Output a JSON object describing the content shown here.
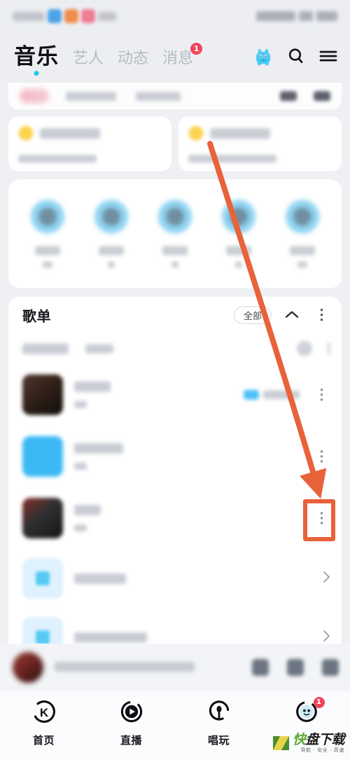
{
  "statusbar": {
    "left_label": "blurred-carrier",
    "right_label": "blurred-indicators"
  },
  "header": {
    "tabs": [
      {
        "label": "音乐",
        "active": true,
        "badge": ""
      },
      {
        "label": "艺人",
        "active": false,
        "badge": ""
      },
      {
        "label": "动态",
        "active": false,
        "badge": ""
      },
      {
        "label": "消息",
        "active": false,
        "badge": "1"
      }
    ],
    "actions": [
      {
        "name": "mascot-icon",
        "label": ""
      },
      {
        "name": "search-icon",
        "label": ""
      },
      {
        "name": "hamburger-menu-icon",
        "label": ""
      }
    ],
    "accent_color": "#1fc6e8",
    "badge_color": "#f2445b"
  },
  "promo": {
    "cards": [
      {
        "title": "blurred-title",
        "subtitle": "blurred-subtitle"
      },
      {
        "title": "blurred-title",
        "subtitle": "blurred-subtitle"
      }
    ]
  },
  "icon_grid": {
    "items": [
      {
        "label": "blurred",
        "sub": ""
      },
      {
        "label": "blurred",
        "sub": ""
      },
      {
        "label": "blurred",
        "sub": ""
      },
      {
        "label": "blurred",
        "sub": ""
      },
      {
        "label": "blurred",
        "sub": ""
      }
    ],
    "circle_color": "#8fd4f2"
  },
  "playlist": {
    "title": "歌单",
    "all_label": "全部",
    "collapse_icon": "chevron-up-icon",
    "more_icon": "more-vertical-icon",
    "rows": [
      {
        "name": "playlist-row-1",
        "title": "blurred",
        "sub": "blurred",
        "tag": "blurred-tag",
        "trailing": "more-vertical-icon"
      },
      {
        "name": "playlist-row-2",
        "title": "blurred",
        "sub": "blurred",
        "tag": "",
        "trailing": "more-vertical-icon"
      },
      {
        "name": "playlist-row-3",
        "title": "blurred",
        "sub": "blurred",
        "tag": "",
        "trailing": "more-vertical-icon"
      },
      {
        "name": "playlist-row-4",
        "title": "blurred",
        "sub": "",
        "tag": "",
        "trailing": "chevron-right-icon"
      },
      {
        "name": "playlist-row-5",
        "title": "blurred",
        "sub": "",
        "tag": "",
        "trailing": "chevron-right-icon"
      }
    ]
  },
  "miniplayer": {
    "track": "blurred-track-name",
    "buttons": [
      "playlist-icon",
      "play-pause-icon",
      "queue-icon"
    ]
  },
  "bottomnav": {
    "items": [
      {
        "label": "首页",
        "icon": "home-k-icon",
        "badge": ""
      },
      {
        "label": "直播",
        "icon": "live-play-icon",
        "badge": ""
      },
      {
        "label": "唱玩",
        "icon": "mic-sing-icon",
        "badge": ""
      },
      {
        "label": "",
        "icon": "profile-avatar-icon",
        "badge": "1"
      }
    ]
  },
  "watermark": {
    "main_first": "快",
    "main_rest": "盘下载",
    "sub": "导航 · 安全 · 高速"
  },
  "annotation": {
    "arrow_color": "#e8623a",
    "highlight_target": "playlist-row-3-more-vertical-icon",
    "arrow_start": "300,205",
    "arrow_end": "455,706",
    "box_rect": "433,712,46,60"
  }
}
